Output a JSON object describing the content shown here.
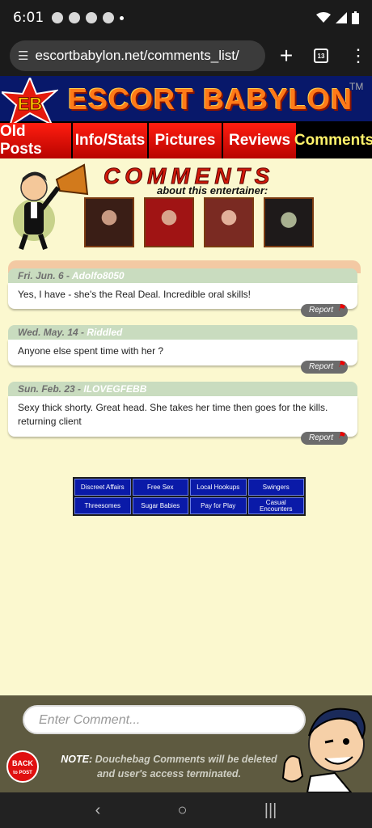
{
  "status": {
    "time": "6:01"
  },
  "browser": {
    "url": "escortbabylon.net/comments_list/",
    "tab_count": "13"
  },
  "site": {
    "brand": "ESCORT BABYLON",
    "logo": "EB",
    "tm": "TM"
  },
  "nav": [
    {
      "label": "Old Posts"
    },
    {
      "label": "Info/Stats"
    },
    {
      "label": "Pictures"
    },
    {
      "label": "Reviews"
    },
    {
      "label": "Comments"
    }
  ],
  "header": {
    "title": "COMMENTS",
    "subtitle": "about this entertainer:"
  },
  "comments": [
    {
      "date": "Fri. Jun. 6",
      "user": "Adolfo8050",
      "text": "Yes, I have - she's the Real Deal. Incredible oral skills!",
      "report": "Report"
    },
    {
      "date": "Wed. May. 14",
      "user": "Riddled",
      "text": "Anyone else spent time with her ?",
      "report": "Report"
    },
    {
      "date": "Sun. Feb. 23",
      "user": "ILOVEGFEBB",
      "text": "Sexy thick shorty. Great head. She takes her time then goes for the kills. returning client",
      "report": "Report"
    }
  ],
  "ads": [
    "Discreet Affairs",
    "Free Sex",
    "Local Hookups",
    "Swingers",
    "Threesomes",
    "Sugar Babies",
    "Pay for Play",
    "Casual Encounters"
  ],
  "comment_bar": {
    "placeholder": "Enter Comment...",
    "back_line1": "BACK",
    "back_line2": "to POST",
    "note_label": "NOTE:",
    "note_text": "Douchebag Comments will be deleted and user's access terminated."
  },
  "icons": {
    "status": [
      "photo-icon",
      "chat-icon",
      "chat-icon",
      "facebook-icon",
      "wifi-icon",
      "signal-icon",
      "battery-icon"
    ],
    "nav": [
      "back-icon",
      "home-icon",
      "recents-icon"
    ]
  }
}
